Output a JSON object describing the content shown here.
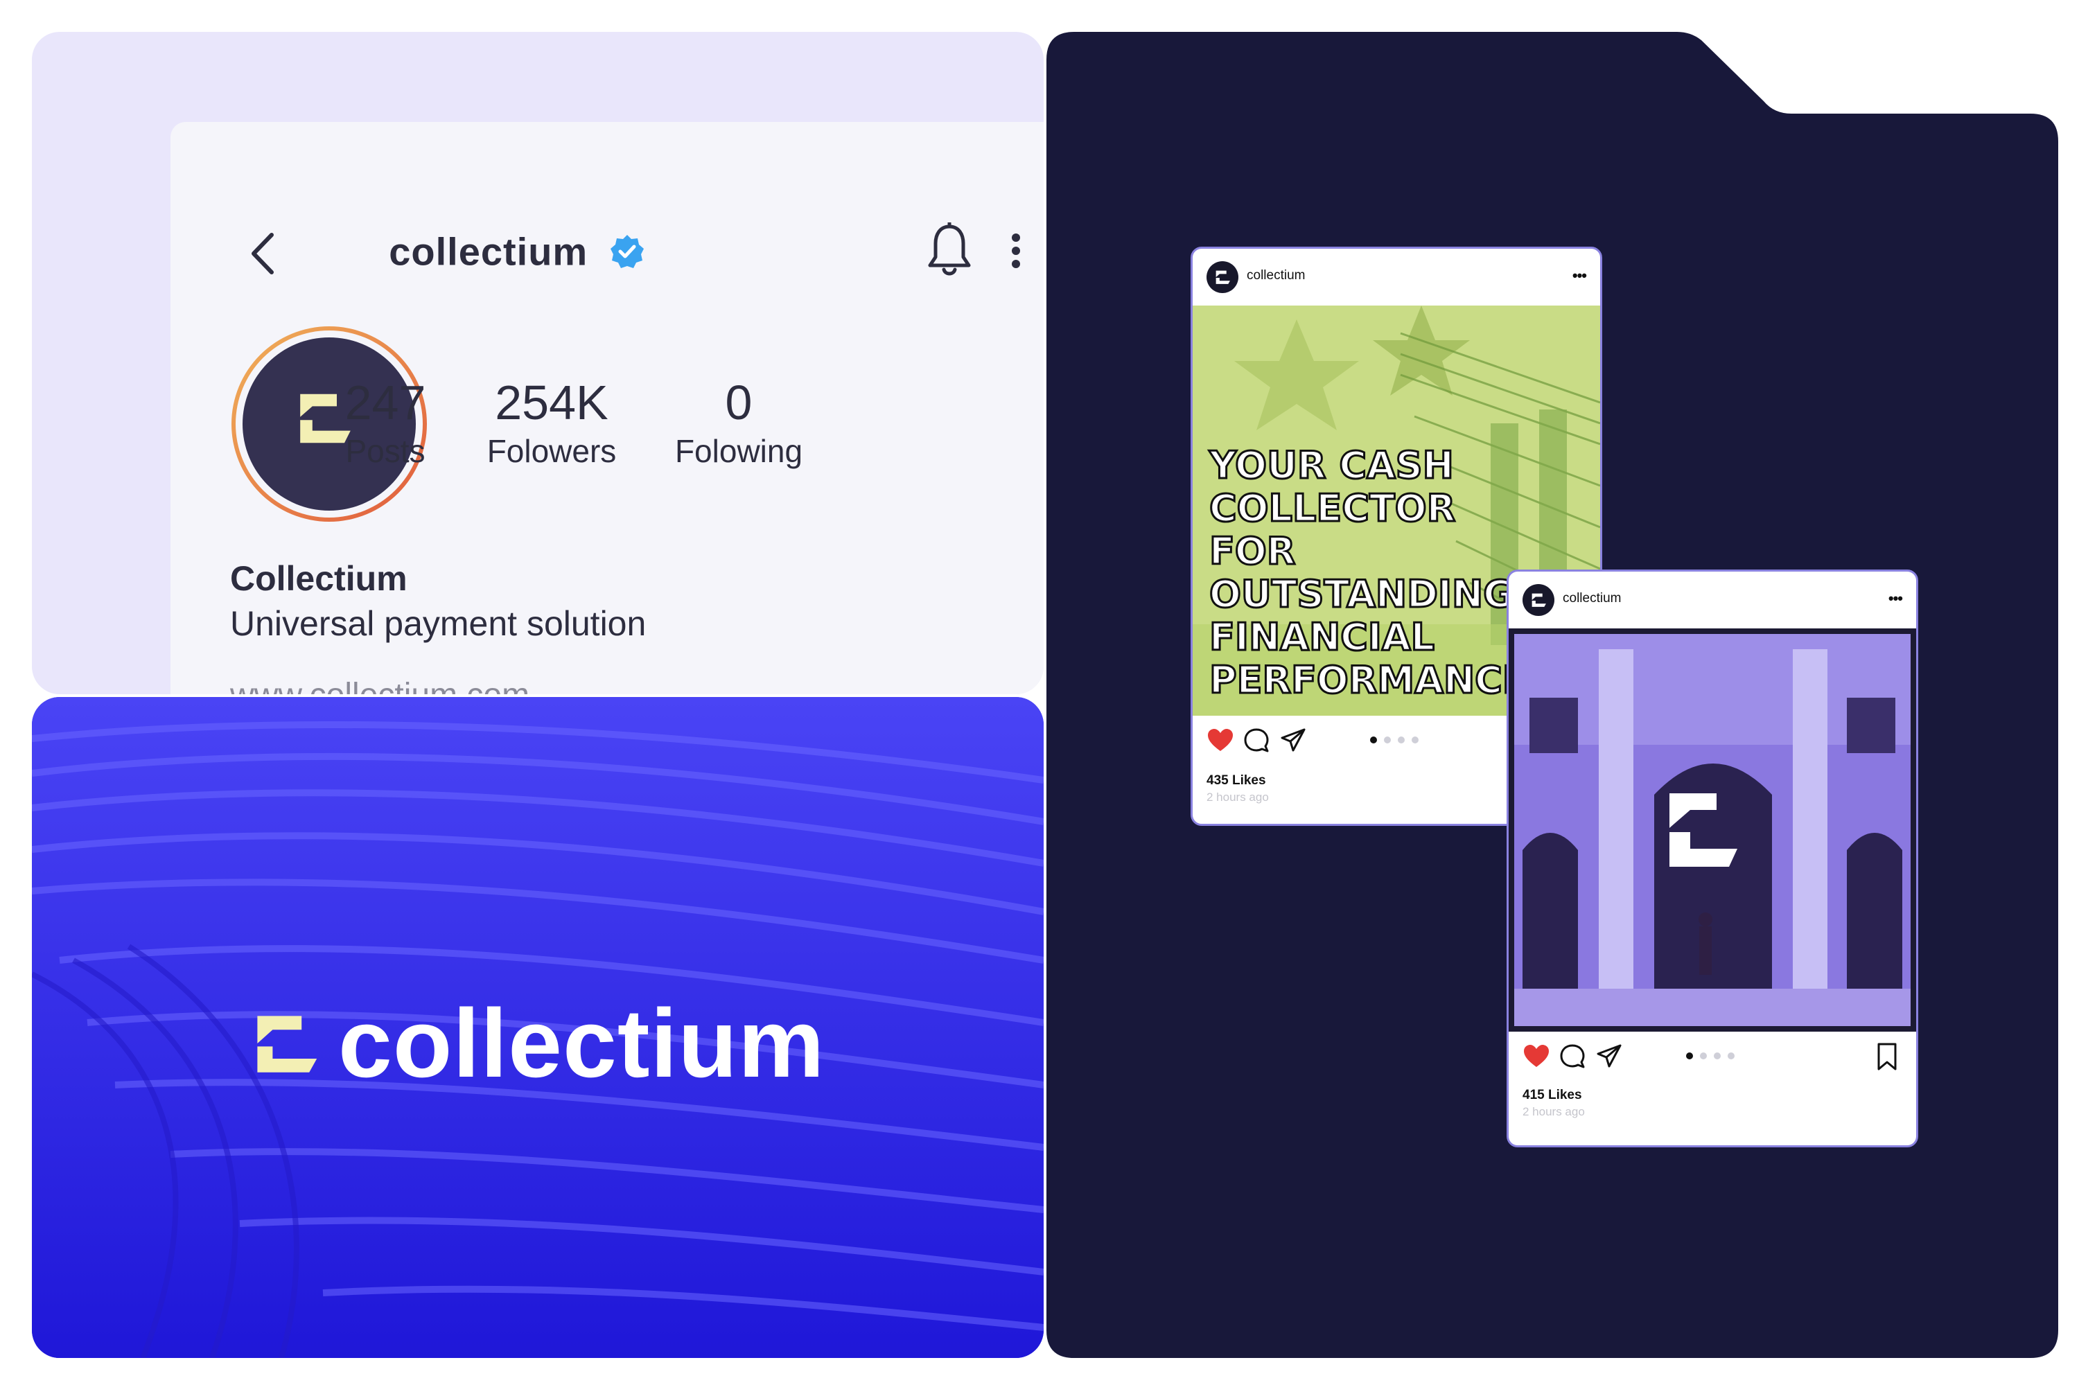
{
  "profile": {
    "username": "collectium",
    "stats": [
      {
        "value": "247",
        "label": "Posts"
      },
      {
        "value": "254K",
        "label": "Folowers"
      },
      {
        "value": "0",
        "label": "Folowing"
      }
    ],
    "name": "Collectium",
    "description": "Universal payment solution",
    "website": "www.collectium.com"
  },
  "banner": {
    "wordmark": "collectium"
  },
  "posts": [
    {
      "username": "collectium",
      "headline": [
        "YOUR CASH",
        "COLLECTOR",
        "FOR",
        "OUTSTANDING",
        "FINANCIAL",
        "PERFORMANCE."
      ],
      "likes": "435 Likes",
      "time": "2 hours ago",
      "carousel_count": 4,
      "carousel_active": 1
    },
    {
      "username": "collectium",
      "likes": "415 Likes",
      "time": "2 hours ago",
      "carousel_count": 4,
      "carousel_active": 1
    }
  ],
  "colors": {
    "brand_dark": "#18183a",
    "brand_blue": "#2d22e8",
    "brand_lavender": "#e9e6fb",
    "logo_cream": "#f3efb4",
    "verified": "#3aa3f0",
    "like_red": "#e53935"
  },
  "icons": [
    "back-icon",
    "verified-icon",
    "bell-icon",
    "more-icon",
    "heart-icon",
    "comment-icon",
    "share-icon",
    "bookmark-icon"
  ]
}
